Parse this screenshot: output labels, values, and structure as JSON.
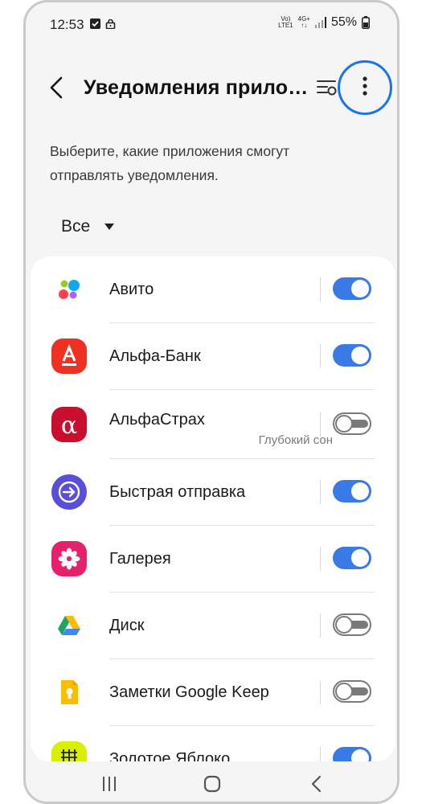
{
  "status_bar": {
    "time": "12:53",
    "battery": "55%",
    "network": "4G+",
    "volte": "Vo)\nLTE1"
  },
  "header": {
    "title": "Уведомления прило…"
  },
  "description": "Выберите, какие приложения смогут отправлять уведомления.",
  "filter": {
    "selected": "Все"
  },
  "apps": [
    {
      "name": "Авито",
      "subtitle": "",
      "enabled": true,
      "icon": "avito-icon"
    },
    {
      "name": "Альфа-Банк",
      "subtitle": "",
      "enabled": true,
      "icon": "alfa-bank-icon"
    },
    {
      "name": "АльфаСтрах",
      "subtitle": "Глубокий сон",
      "enabled": false,
      "icon": "alfastrah-icon"
    },
    {
      "name": "Быстрая отправка",
      "subtitle": "",
      "enabled": true,
      "icon": "quick-share-icon"
    },
    {
      "name": "Галерея",
      "subtitle": "",
      "enabled": true,
      "icon": "gallery-icon"
    },
    {
      "name": "Диск",
      "subtitle": "",
      "enabled": false,
      "icon": "google-drive-icon"
    },
    {
      "name": "Заметки Google Keep",
      "subtitle": "",
      "enabled": false,
      "icon": "google-keep-icon"
    },
    {
      "name": "Золотое Яблоко",
      "subtitle": "",
      "enabled": true,
      "icon": "zolotoe-yabloko-icon"
    }
  ],
  "colors": {
    "accent": "#3a7ae6",
    "highlight_ring": "#1a73e8",
    "background": "#f5f5f5"
  }
}
